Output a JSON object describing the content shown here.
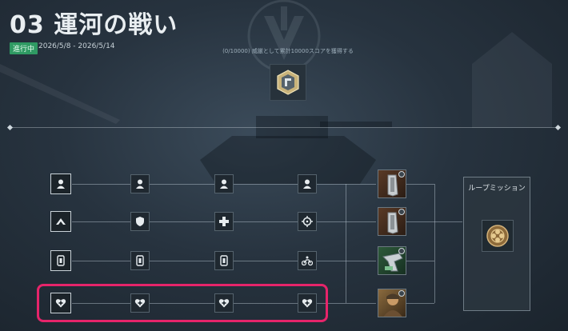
{
  "page": {
    "title": "03 運河の戦い",
    "status": "進行中",
    "date_range": "2026/5/8 - 2026/5/14",
    "objective": "(0/10000) 威厳として累計10000スコアを獲得する"
  },
  "loop_panel": {
    "title": "ループミッション",
    "icon": "bronze-medal-icon"
  },
  "rows": [
    {
      "icons": [
        "soldier-icon",
        "soldier-icon",
        "soldier-icon",
        "soldier-icon"
      ],
      "reward": "ammo-magazine-reward"
    },
    {
      "icons": [
        "rank-chevron-icon",
        "shield-icon",
        "cross-icon",
        "crosshair-icon"
      ],
      "reward": "ammo-magazine-reward"
    },
    {
      "icons": [
        "vehicle-badge-icon",
        "vehicle-badge-icon",
        "vehicle-badge-icon",
        "motorbike-icon"
      ],
      "reward": "weapon-skin-reward"
    },
    {
      "icons": [
        "medic-heart-icon",
        "medic-heart-icon",
        "medic-heart-icon",
        "medic-heart-icon"
      ],
      "reward": "soldier-portrait-reward"
    }
  ],
  "colors": {
    "status_green": "#2f9a63",
    "highlight_pink": "#e6246a"
  }
}
